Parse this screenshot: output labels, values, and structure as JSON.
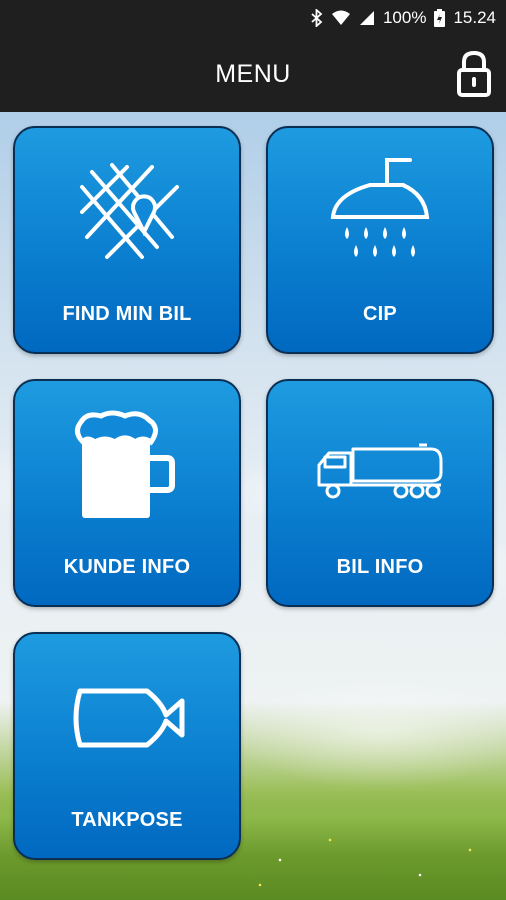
{
  "status_bar": {
    "battery": "100%",
    "time": "15.24",
    "icons": [
      "bluetooth-icon",
      "wifi-icon",
      "signal-icon",
      "battery-icon"
    ]
  },
  "app_bar": {
    "title": "MENU",
    "lock_icon": "lock-icon"
  },
  "menu": {
    "items": [
      {
        "label": "FIND MIN BIL",
        "icon": "map-pin-icon"
      },
      {
        "label": "CIP",
        "icon": "shower-icon"
      },
      {
        "label": "KUNDE INFO",
        "icon": "beer-mug-icon"
      },
      {
        "label": "BIL INFO",
        "icon": "tanker-truck-icon"
      },
      {
        "label": "TANKPOSE",
        "icon": "tank-bag-icon"
      }
    ]
  },
  "colors": {
    "tile_top": "#1e9be0",
    "tile_bottom": "#0068c0",
    "bar_background": "#1f1f1f"
  }
}
